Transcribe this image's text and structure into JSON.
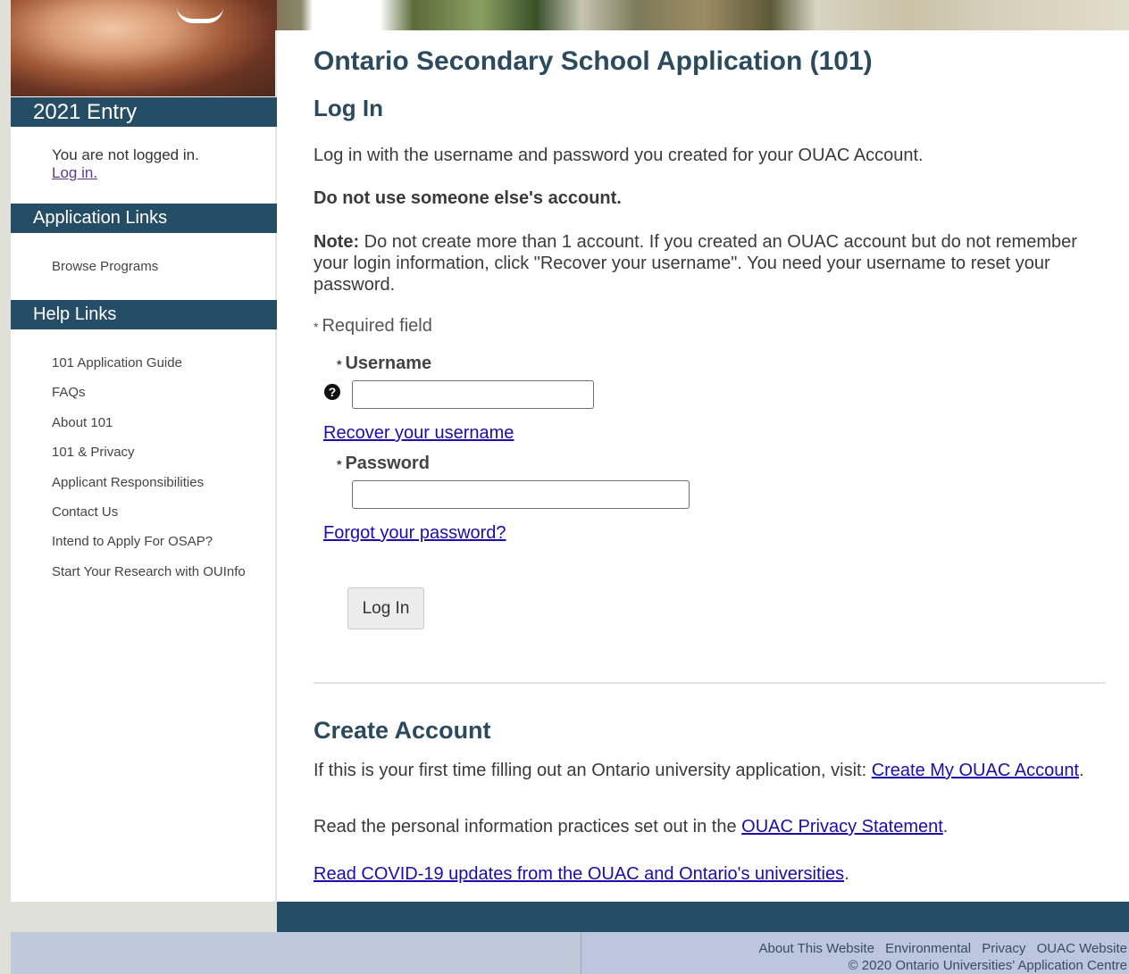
{
  "sidebar": {
    "entry_heading": "2021 Entry",
    "status_text": "You are not logged in.",
    "login_link": "Log in.",
    "app_links_heading": "Application Links",
    "app_links": [
      "Browse Programs"
    ],
    "help_links_heading": "Help Links",
    "help_links": [
      "101 Application Guide",
      "FAQs",
      "About 101",
      "101 & Privacy",
      "Applicant Responsibilities",
      "Contact Us",
      "Intend to Apply For OSAP?",
      "Start Your Research with OUInfo"
    ]
  },
  "main": {
    "title": "Ontario Secondary School Application (101)",
    "login_heading": "Log In",
    "intro": "Log in with the username and password you created for your OUAC Account.",
    "warning": "Do not use someone else's account.",
    "note_label": "Note:",
    "note_text": " Do not create more than 1 account. If you created an OUAC account but do not remember your login information, click \"Recover your username\". You need your username to reset your password.",
    "required_text": "Required field",
    "asterisk": "*",
    "username_label": "Username",
    "username_value": "",
    "help_icon_glyph": "?",
    "recover_link": "Recover your username",
    "password_label": "Password",
    "password_value": "",
    "forgot_link": "Forgot your password?",
    "login_button": "Log In",
    "create_heading": "Create Account",
    "create_text": "If this is your first time filling out an Ontario university application, visit: ",
    "create_link": "Create My OUAC Account",
    "create_end": ".",
    "privacy_text": "Read the personal information practices set out in the ",
    "privacy_link": "OUAC Privacy Statement",
    "privacy_end": ".",
    "covid_link": "Read COVID-19 updates from the OUAC and Ontario's universities",
    "covid_end": "."
  },
  "footer": {
    "links": [
      "About This Website",
      "Environmental",
      "Privacy",
      "OUAC Website"
    ],
    "copyright": "© 2020 Ontario Universities' Application Centre"
  },
  "colors": {
    "header_bar": "#264d66",
    "link": "#1a0dab",
    "footer_bg": "#bcc7dd"
  }
}
